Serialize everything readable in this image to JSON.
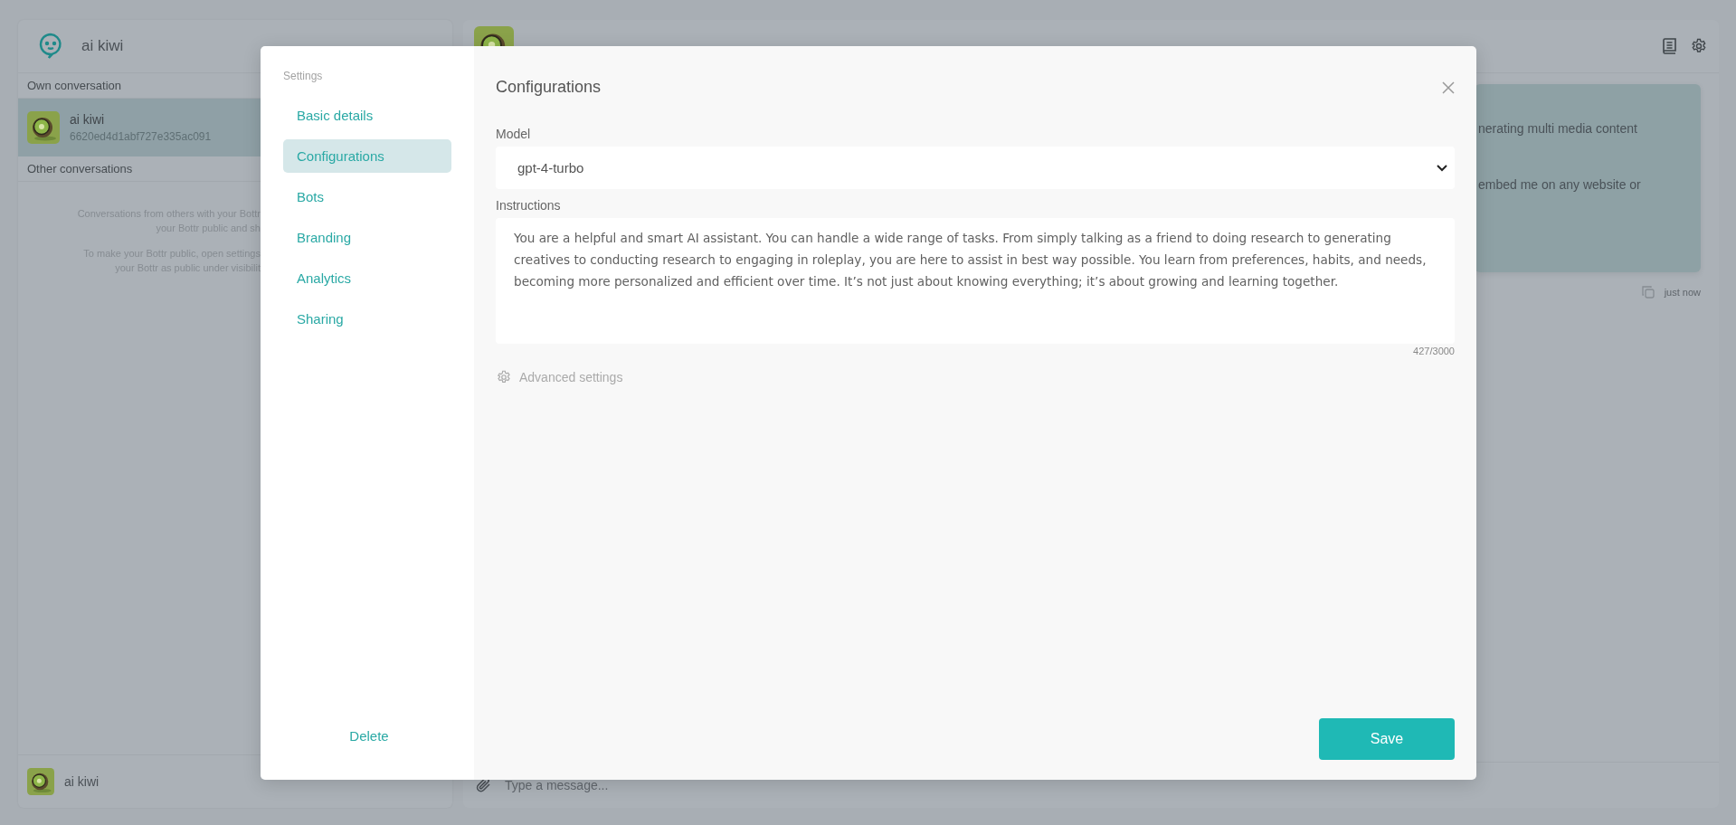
{
  "sidebar": {
    "title": "ai kiwi",
    "own_label": "Own conversation",
    "own_items": [
      {
        "name": "ai kiwi",
        "id": "6620ed4d1abf727e335ac091",
        "selected": true
      }
    ],
    "other_label": "Other conversations",
    "empty_paragraphs": [
      [
        "Conversations from others with your Bottr",
        "your Bottr public and sh"
      ],
      [
        "To make your Bottr public, open settings",
        "your Bottr as public under visibilit"
      ]
    ],
    "footer_name": "ai kiwi"
  },
  "chat": {
    "message_lines": [
      "nerating multi media content",
      "embed me on any website or"
    ],
    "timestamp": "just now",
    "composer": {
      "placeholder": "Type a message..."
    }
  },
  "dialog": {
    "nav_title": "Settings",
    "nav_items": [
      {
        "label": "Basic details",
        "selected": false
      },
      {
        "label": "Configurations",
        "selected": true
      },
      {
        "label": "Bots",
        "selected": false
      },
      {
        "label": "Branding",
        "selected": false
      },
      {
        "label": "Analytics",
        "selected": false
      },
      {
        "label": "Sharing",
        "selected": false
      }
    ],
    "delete": "Delete",
    "title": "Configurations",
    "model": {
      "label": "Model",
      "value": "gpt-4-turbo"
    },
    "instructions": {
      "label": "Instructions",
      "value": "You are a helpful and smart AI assistant. You can handle a wide range of tasks. From simply talking as a friend to doing research to generating creatives to conducting research to engaging in roleplay, you are here to assist in best way possible. You learn from preferences, habits, and needs, becoming more personalized and efficient over time. It’s not just about knowing everything; it’s about growing and learning together.",
      "count": "427/3000"
    },
    "advanced": "Advanced settings",
    "save": "Save"
  }
}
